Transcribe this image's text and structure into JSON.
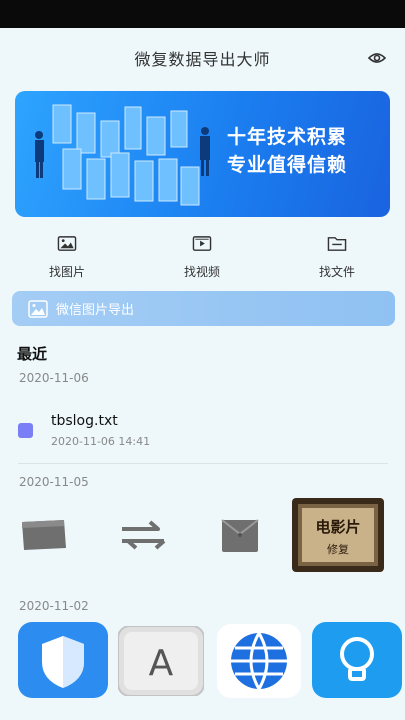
{
  "app": {
    "title": "微复数据导出大师"
  },
  "banner": {
    "line1": "十年技术积累",
    "line2": "专业值得信赖"
  },
  "quick_actions": [
    {
      "label": "找图片",
      "icon": "image-icon"
    },
    {
      "label": "找视频",
      "icon": "video-icon"
    },
    {
      "label": "找文件",
      "icon": "folder-icon"
    }
  ],
  "wechat_export": {
    "label": "微信图片导出",
    "icon": "image-icon"
  },
  "recent": {
    "title": "最近",
    "groups": [
      {
        "date": "2020-11-06",
        "files": [
          {
            "name": "tbslog.txt",
            "time": "2020-11-06 14:41",
            "icon": "text-file-icon"
          }
        ]
      },
      {
        "date": "2020-11-05",
        "thumbs": [
          "wallet-icon",
          "swap-arrows-icon",
          "bag-icon",
          "movie-poster-thumbnail"
        ],
        "poster_text": {
          "line1": "电影片",
          "line2": "修复"
        }
      },
      {
        "date": "2020-11-02",
        "thumbs": [
          "shield-app-icon",
          "font-app-icon",
          "browser-globe-icon",
          "idea-bulb-app-icon"
        ]
      }
    ]
  },
  "colors": {
    "accent": "#1b7ff0",
    "background": "#eef8fb",
    "file_icon": "#7b7ff5"
  }
}
